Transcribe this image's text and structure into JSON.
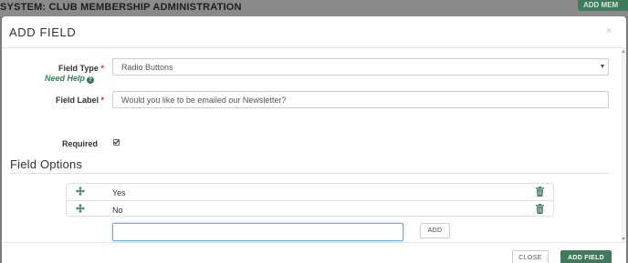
{
  "background": {
    "title": "SYSTEM: CLUB MEMBERSHIP ADMINISTRATION",
    "top_button_label": "ADD MEM"
  },
  "modal": {
    "title": "ADD FIELD",
    "close_glyph": "×"
  },
  "form": {
    "field_type": {
      "label": "Field Type",
      "required_mark": "*",
      "help_text": "Need Help",
      "help_glyph": "?",
      "selected_value": "Radio Buttons"
    },
    "field_label": {
      "label": "Field Label",
      "required_mark": "*",
      "value": "Would you like to be emailed our Newsletter?"
    },
    "required": {
      "label": "Required",
      "checked": true
    }
  },
  "field_options": {
    "title": "Field Options",
    "items": [
      {
        "label": "Yes"
      },
      {
        "label": "No"
      }
    ],
    "new_option_value": "",
    "add_button_label": "ADD"
  },
  "footer": {
    "close_label": "CLOSE",
    "add_field_label": "ADD FIELD"
  },
  "colors": {
    "accent_green": "#3f7a5a",
    "required_red": "#c9302c",
    "focus_blue": "#66afe9"
  },
  "icons": {
    "reorder": "move-icon",
    "delete": "trash-icon",
    "help": "question-circle-icon"
  }
}
